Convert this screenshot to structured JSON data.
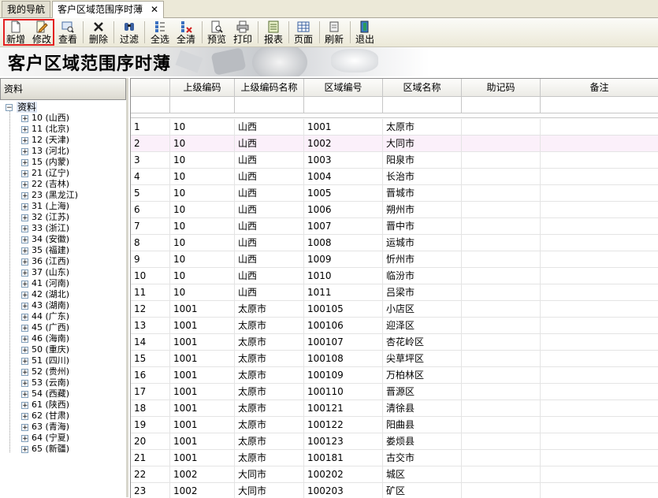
{
  "tabs": [
    {
      "label": "我的导航"
    },
    {
      "label": "客户区域范围序时薄",
      "close": "✕"
    }
  ],
  "toolbar": {
    "buttons": [
      {
        "label": "新增",
        "icon": "new-doc-icon"
      },
      {
        "label": "修改",
        "icon": "edit-icon"
      },
      {
        "label": "查看",
        "icon": "view-icon"
      },
      {
        "label": "删除",
        "icon": "delete-icon"
      },
      {
        "label": "过滤",
        "icon": "filter-icon"
      },
      {
        "label": "全选",
        "icon": "select-all-icon"
      },
      {
        "label": "全清",
        "icon": "clear-all-icon"
      },
      {
        "label": "预览",
        "icon": "preview-icon"
      },
      {
        "label": "打印",
        "icon": "print-icon"
      },
      {
        "label": "报表",
        "icon": "report-icon"
      },
      {
        "label": "页面",
        "icon": "page-icon"
      },
      {
        "label": "刷新",
        "icon": "refresh-icon"
      },
      {
        "label": "退出",
        "icon": "exit-icon"
      }
    ]
  },
  "banner": {
    "title": "客户区域范围序时薄"
  },
  "left": {
    "header": "资料",
    "root": "资料",
    "root_toggle": "−",
    "child_toggle": "+",
    "nodes": [
      "10 (山西)",
      "11 (北京)",
      "12 (天津)",
      "13 (河北)",
      "15 (内蒙)",
      "21 (辽宁)",
      "22 (吉林)",
      "23 (黑龙江)",
      "31 (上海)",
      "32 (江苏)",
      "33 (浙江)",
      "34 (安徽)",
      "35 (福建)",
      "36 (江西)",
      "37 (山东)",
      "41 (河南)",
      "42 (湖北)",
      "43 (湖南)",
      "44 (广东)",
      "45 (广西)",
      "46 (海南)",
      "50 (重庆)",
      "51 (四川)",
      "52 (贵州)",
      "53 (云南)",
      "54 (西藏)",
      "61 (陕西)",
      "62 (甘肃)",
      "63 (青海)",
      "64 (宁夏)",
      "65 (新疆)"
    ]
  },
  "grid": {
    "columns": [
      "",
      "上级编码",
      "上级编码名称",
      "区域编号",
      "区域名称",
      "助记码",
      "备注"
    ],
    "rows": [
      [
        "1",
        "10",
        "山西",
        "1001",
        "太原市",
        "",
        ""
      ],
      [
        "2",
        "10",
        "山西",
        "1002",
        "大同市",
        "",
        ""
      ],
      [
        "3",
        "10",
        "山西",
        "1003",
        "阳泉市",
        "",
        ""
      ],
      [
        "4",
        "10",
        "山西",
        "1004",
        "长治市",
        "",
        ""
      ],
      [
        "5",
        "10",
        "山西",
        "1005",
        "晋城市",
        "",
        ""
      ],
      [
        "6",
        "10",
        "山西",
        "1006",
        "朔州市",
        "",
        ""
      ],
      [
        "7",
        "10",
        "山西",
        "1007",
        "晋中市",
        "",
        ""
      ],
      [
        "8",
        "10",
        "山西",
        "1008",
        "运城市",
        "",
        ""
      ],
      [
        "9",
        "10",
        "山西",
        "1009",
        "忻州市",
        "",
        ""
      ],
      [
        "10",
        "10",
        "山西",
        "1010",
        "临汾市",
        "",
        ""
      ],
      [
        "11",
        "10",
        "山西",
        "1011",
        "吕梁市",
        "",
        ""
      ],
      [
        "12",
        "1001",
        "太原市",
        "100105",
        "小店区",
        "",
        ""
      ],
      [
        "13",
        "1001",
        "太原市",
        "100106",
        "迎泽区",
        "",
        ""
      ],
      [
        "14",
        "1001",
        "太原市",
        "100107",
        "杏花岭区",
        "",
        ""
      ],
      [
        "15",
        "1001",
        "太原市",
        "100108",
        "尖草坪区",
        "",
        ""
      ],
      [
        "16",
        "1001",
        "太原市",
        "100109",
        "万柏林区",
        "",
        ""
      ],
      [
        "17",
        "1001",
        "太原市",
        "100110",
        "晋源区",
        "",
        ""
      ],
      [
        "18",
        "1001",
        "太原市",
        "100121",
        "清徐县",
        "",
        ""
      ],
      [
        "19",
        "1001",
        "太原市",
        "100122",
        "阳曲县",
        "",
        ""
      ],
      [
        "20",
        "1001",
        "太原市",
        "100123",
        "娄烦县",
        "",
        ""
      ],
      [
        "21",
        "1001",
        "太原市",
        "100181",
        "古交市",
        "",
        ""
      ],
      [
        "22",
        "1002",
        "大同市",
        "100202",
        "城区",
        "",
        ""
      ],
      [
        "23",
        "1002",
        "大同市",
        "100203",
        "矿区",
        "",
        ""
      ]
    ],
    "highlight_color": "#fbf0fa"
  }
}
